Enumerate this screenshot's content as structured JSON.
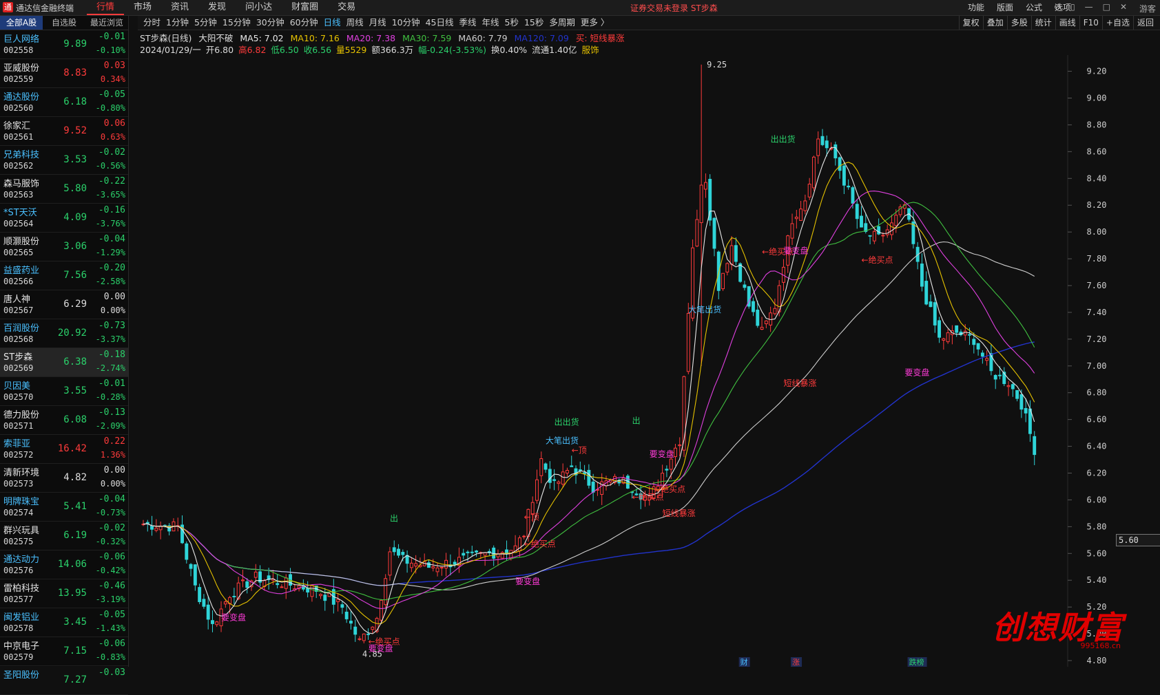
{
  "app": {
    "title": "通达信金融终端",
    "logo": "通",
    "notice": "证券交易未登录  ST步森",
    "guest": "游客"
  },
  "menu": [
    "行情",
    "市场",
    "资讯",
    "发现",
    "问小达",
    "财富圈",
    "交易"
  ],
  "right_menu": [
    "功能",
    "版面",
    "公式",
    "选项"
  ],
  "title_icons": [
    "⊘",
    "▯",
    "—",
    "□",
    "✕"
  ],
  "sidebar": {
    "tabs": [
      "全部A股",
      "自选股",
      "最近浏览"
    ],
    "rows": [
      {
        "name": "巨人网络",
        "code": "002558",
        "price": "9.89",
        "chg": "-0.01",
        "pct": "-0.10%",
        "dir": "g"
      },
      {
        "name": "亚威股份",
        "code": "002559",
        "price": "8.83",
        "chg": "0.03",
        "pct": "0.34%",
        "dir": "r"
      },
      {
        "name": "通达股份",
        "code": "002560",
        "price": "6.18",
        "chg": "-0.05",
        "pct": "-0.80%",
        "dir": "g"
      },
      {
        "name": "徐家汇",
        "code": "002561",
        "price": "9.52",
        "chg": "0.06",
        "pct": "0.63%",
        "dir": "r"
      },
      {
        "name": "兄弟科技",
        "code": "002562",
        "price": "3.53",
        "chg": "-0.02",
        "pct": "-0.56%",
        "dir": "g"
      },
      {
        "name": "森马服饰",
        "code": "002563",
        "price": "5.80",
        "chg": "-0.22",
        "pct": "-3.65%",
        "dir": "g"
      },
      {
        "name": "*ST天沃",
        "code": "002564",
        "price": "4.09",
        "chg": "-0.16",
        "pct": "-3.76%",
        "dir": "g"
      },
      {
        "name": "顺灏股份",
        "code": "002565",
        "price": "3.06",
        "chg": "-0.04",
        "pct": "-1.29%",
        "dir": "g"
      },
      {
        "name": "益盛药业",
        "code": "002566",
        "price": "7.56",
        "chg": "-0.20",
        "pct": "-2.58%",
        "dir": "g"
      },
      {
        "name": "唐人神",
        "code": "002567",
        "price": "6.29",
        "chg": "0.00",
        "pct": "0.00%",
        "dir": "w"
      },
      {
        "name": "百润股份",
        "code": "002568",
        "price": "20.92",
        "chg": "-0.73",
        "pct": "-3.37%",
        "dir": "g"
      },
      {
        "name": "ST步森",
        "code": "002569",
        "price": "6.38",
        "chg": "-0.18",
        "pct": "-2.74%",
        "dir": "g",
        "selected": true
      },
      {
        "name": "贝因美",
        "code": "002570",
        "price": "3.55",
        "chg": "-0.01",
        "pct": "-0.28%",
        "dir": "g"
      },
      {
        "name": "德力股份",
        "code": "002571",
        "price": "6.08",
        "chg": "-0.13",
        "pct": "-2.09%",
        "dir": "g"
      },
      {
        "name": "索菲亚",
        "code": "002572",
        "price": "16.42",
        "chg": "0.22",
        "pct": "1.36%",
        "dir": "r"
      },
      {
        "name": "清新环境",
        "code": "002573",
        "price": "4.82",
        "chg": "0.00",
        "pct": "0.00%",
        "dir": "w"
      },
      {
        "name": "明牌珠宝",
        "code": "002574",
        "price": "5.41",
        "chg": "-0.04",
        "pct": "-0.73%",
        "dir": "g"
      },
      {
        "name": "群兴玩具",
        "code": "002575",
        "price": "6.19",
        "chg": "-0.02",
        "pct": "-0.32%",
        "dir": "g"
      },
      {
        "name": "通达动力",
        "code": "002576",
        "price": "14.06",
        "chg": "-0.06",
        "pct": "-0.42%",
        "dir": "g"
      },
      {
        "name": "雷柏科技",
        "code": "002577",
        "price": "13.95",
        "chg": "-0.46",
        "pct": "-3.19%",
        "dir": "g"
      },
      {
        "name": "闽发铝业",
        "code": "002578",
        "price": "3.45",
        "chg": "-0.05",
        "pct": "-1.43%",
        "dir": "g"
      },
      {
        "name": "中京电子",
        "code": "002579",
        "price": "7.15",
        "chg": "-0.06",
        "pct": "-0.83%",
        "dir": "g"
      },
      {
        "name": "圣阳股份",
        "code": "",
        "price": "7.27",
        "chg": "-0.03",
        "pct": "",
        "dir": "g"
      }
    ]
  },
  "periods": [
    "分时",
    "1分钟",
    "5分钟",
    "15分钟",
    "30分钟",
    "60分钟",
    "日线",
    "周线",
    "月线",
    "10分钟",
    "45日线",
    "季线",
    "年线",
    "5秒",
    "15秒",
    "多周期",
    "更多 〉"
  ],
  "period_active": "日线",
  "tools": [
    "复权",
    "叠加",
    "多股",
    "统计",
    "画线",
    "F10",
    "+自选",
    "返回"
  ],
  "info": {
    "title": "ST步森(日线)",
    "pattern": "大阳不破",
    "ma5": "MA5: 7.02",
    "ma10": "MA10: 7.16",
    "ma20": "MA20: 7.38",
    "ma30": "MA30: 7.59",
    "ma60": "MA60: 7.79",
    "ma120": "MA120: 7.09",
    "signal": "买: 短线暴涨",
    "date": "2024/01/29/一",
    "open": "开6.80",
    "high": "高6.82",
    "low": "低6.50",
    "close": "收6.56",
    "vol": "量5529",
    "amount": "额366.3万",
    "range": "幅-0.24(-3.53%)",
    "turnover": "换0.40%",
    "float": "流通1.40亿",
    "sector": "服饰"
  },
  "colors": {
    "up": "#ff3b3b",
    "down": "#2fd4d8",
    "ma5": "#e8e8e8",
    "ma10": "#e6c200",
    "ma20": "#e040e0",
    "ma30": "#40c040",
    "ma60": "#cfcfcf",
    "ma120": "#2233cc"
  },
  "chart_data": {
    "type": "candlestick",
    "y_ticks": [
      "9.20",
      "9.00",
      "8.80",
      "8.60",
      "8.40",
      "8.20",
      "8.00",
      "7.80",
      "7.60",
      "7.40",
      "7.20",
      "7.00",
      "6.80",
      "6.60",
      "6.40",
      "6.20",
      "6.00",
      "5.80",
      "5.60",
      "5.40",
      "5.20",
      "5.00",
      "4.80"
    ],
    "ylim": [
      4.8,
      9.28
    ],
    "current_price": "5.60",
    "high_label": "9.25",
    "low_label": "4.85",
    "annotations": [
      {
        "text": "出",
        "price": 5.84,
        "x": 57,
        "color": "#2bd16b"
      },
      {
        "text": "出",
        "price": 6.57,
        "x": 113,
        "color": "#2bd16b"
      },
      {
        "text": "出出货",
        "price": 6.56,
        "x": 95,
        "color": "#2bd16b"
      },
      {
        "text": "出出货",
        "price": 8.67,
        "x": 145,
        "color": "#2bd16b"
      },
      {
        "text": "大笔出货",
        "price": 6.42,
        "x": 93,
        "color": "#4ac0ff"
      },
      {
        "text": "大笔出货",
        "price": 7.4,
        "x": 126,
        "color": "#4ac0ff"
      },
      {
        "text": "←顶",
        "price": 6.35,
        "x": 99,
        "color": "#ff3b3b"
      },
      {
        "text": "←顶",
        "price": 5.85,
        "x": 88,
        "color": "#ff3b3b"
      },
      {
        "text": "←绝买点",
        "price": 5.65,
        "x": 88,
        "color": "#ff3b3b"
      },
      {
        "text": "←绝买点",
        "price": 6.0,
        "x": 113,
        "color": "#ff3b3b"
      },
      {
        "text": "←绝买点",
        "price": 6.06,
        "x": 118,
        "color": "#ff3b3b"
      },
      {
        "text": "←绝买点",
        "price": 4.92,
        "x": 52,
        "color": "#ff3b3b"
      },
      {
        "text": "←绝买点",
        "price": 7.83,
        "x": 143,
        "color": "#ff3b3b"
      },
      {
        "text": "←绝买点",
        "price": 7.77,
        "x": 166,
        "color": "#ff3b3b"
      },
      {
        "text": "要变盘",
        "price": 5.1,
        "x": 18,
        "color": "#ff3bd8"
      },
      {
        "text": "要变盘",
        "price": 4.87,
        "x": 52,
        "color": "#ff3bd8"
      },
      {
        "text": "要变盘",
        "price": 5.37,
        "x": 86,
        "color": "#ff3bd8"
      },
      {
        "text": "要变盘",
        "price": 6.32,
        "x": 117,
        "color": "#ff3bd8"
      },
      {
        "text": "要变盘",
        "price": 7.84,
        "x": 148,
        "color": "#ff3bd8"
      },
      {
        "text": "要变盘",
        "price": 6.93,
        "x": 176,
        "color": "#ff3bd8"
      },
      {
        "text": "短线暴涨",
        "price": 5.88,
        "x": 120,
        "color": "#ff3b3b"
      },
      {
        "text": "短线暴涨",
        "price": 6.85,
        "x": 148,
        "color": "#ff3b3b"
      }
    ],
    "bottom_markers": [
      {
        "text": "财",
        "x": 138,
        "color": "#4ac0ff"
      },
      {
        "text": "涨",
        "x": 150,
        "color": "#ff3b3b"
      },
      {
        "text": "跌榜",
        "x": 177,
        "color": "#2bd16b"
      }
    ]
  },
  "watermark": {
    "text": "创想财富",
    "url": "995168.cn"
  }
}
